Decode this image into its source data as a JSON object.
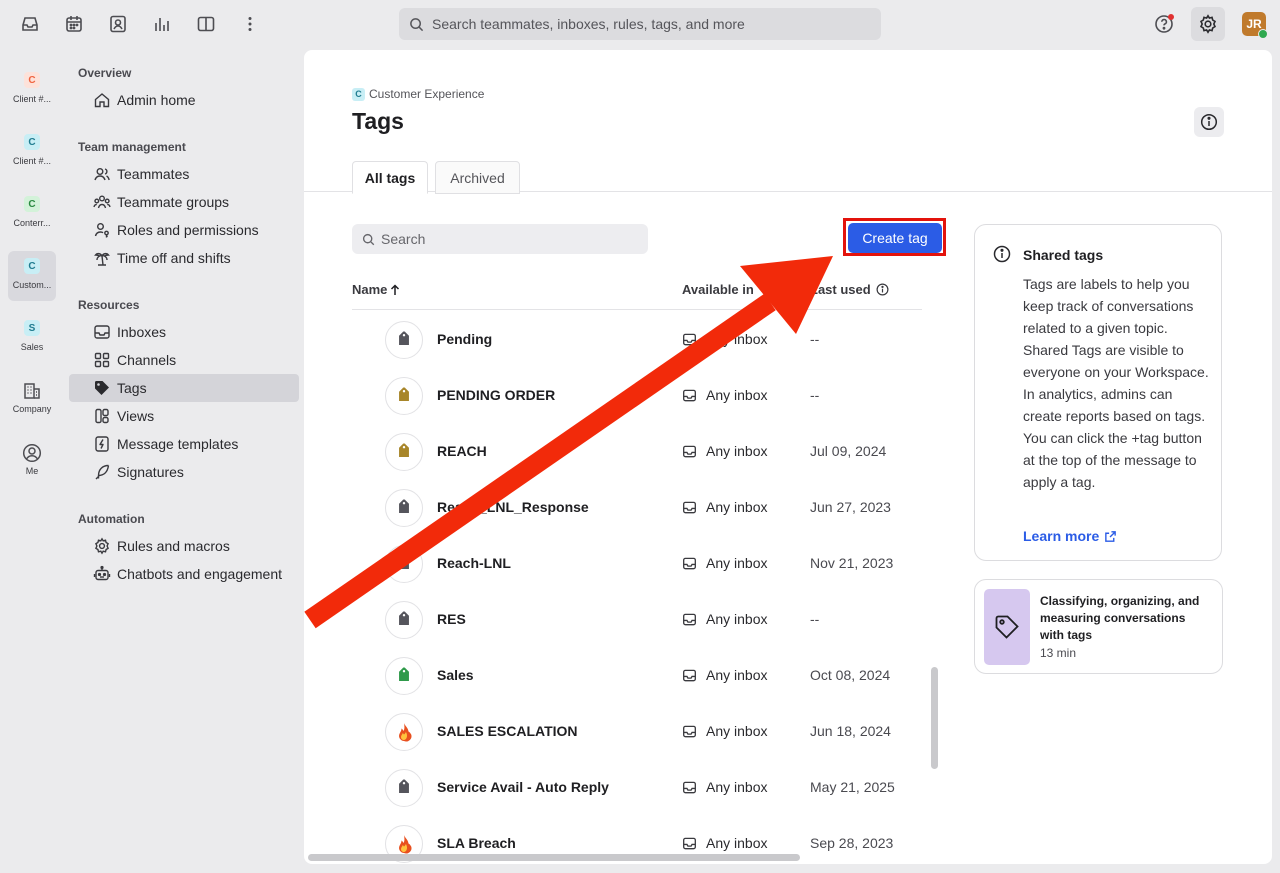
{
  "topbar": {
    "search_placeholder": "Search teammates, inboxes, rules, tags, and more",
    "avatar_initials": "JR"
  },
  "rail": {
    "workspaces": [
      {
        "letter": "C",
        "label": "Client #...",
        "color": "#f0633f",
        "bg": "#fde2da"
      },
      {
        "letter": "C",
        "label": "Client #...",
        "color": "#207c90",
        "bg": "#c8eef5"
      },
      {
        "letter": "C",
        "label": "Conterr...",
        "color": "#2a8a40",
        "bg": "#d3f2d9"
      },
      {
        "letter": "C",
        "label": "Custom...",
        "color": "#207c90",
        "bg": "#c8eef5"
      },
      {
        "letter": "S",
        "label": "Sales",
        "color": "#207c90",
        "bg": "#c8eef5"
      }
    ],
    "company_label": "Company",
    "me_label": "Me"
  },
  "sidebar": {
    "overview": {
      "heading": "Overview",
      "items": [
        "Admin home"
      ]
    },
    "team": {
      "heading": "Team management",
      "items": [
        "Teammates",
        "Teammate groups",
        "Roles and permissions",
        "Time off and shifts"
      ]
    },
    "resources": {
      "heading": "Resources",
      "items": [
        "Inboxes",
        "Channels",
        "Tags",
        "Views",
        "Message templates",
        "Signatures"
      ]
    },
    "automation": {
      "heading": "Automation",
      "items": [
        "Rules and macros",
        "Chatbots and engagement"
      ]
    }
  },
  "main": {
    "breadcrumb_badge": "C",
    "breadcrumb": "Customer Experience",
    "title": "Tags",
    "tabs": [
      "All tags",
      "Archived"
    ],
    "search_placeholder": "Search",
    "create_label": "Create tag",
    "columns": {
      "name": "Name",
      "available": "Available in",
      "last_used": "Last used"
    },
    "rows": [
      {
        "name": "Pending",
        "inbox": "Any inbox",
        "last": "--",
        "icon": "tag",
        "color": "#55555c"
      },
      {
        "name": "PENDING ORDER",
        "inbox": "Any inbox",
        "last": "--",
        "icon": "tag",
        "color": "#a8862a"
      },
      {
        "name": "REACH",
        "inbox": "Any inbox",
        "last": "Jul 09, 2024",
        "icon": "tag",
        "color": "#a8862a"
      },
      {
        "name": "Reach_LNL_Response",
        "inbox": "Any inbox",
        "last": "Jun 27, 2023",
        "icon": "tag",
        "color": "#55555c"
      },
      {
        "name": "Reach-LNL",
        "inbox": "Any inbox",
        "last": "Nov 21, 2023",
        "icon": "tag",
        "color": "#55555c"
      },
      {
        "name": "RES",
        "inbox": "Any inbox",
        "last": "--",
        "icon": "tag",
        "color": "#55555c"
      },
      {
        "name": "Sales",
        "inbox": "Any inbox",
        "last": "Oct 08, 2024",
        "icon": "tag",
        "color": "#2f9a4a"
      },
      {
        "name": "SALES ESCALATION",
        "inbox": "Any inbox",
        "last": "Jun 18, 2024",
        "icon": "fire",
        "color": "#e8501f"
      },
      {
        "name": "Service Avail - Auto Reply",
        "inbox": "Any inbox",
        "last": "May 21, 2025",
        "icon": "tag",
        "color": "#55555c"
      },
      {
        "name": "SLA Breach",
        "inbox": "Any inbox",
        "last": "Sep 28, 2023",
        "icon": "fire",
        "color": "#e8501f"
      }
    ]
  },
  "shared": {
    "title": "Shared tags",
    "body": "Tags are labels to help you keep track of conversations related to a given topic. Shared Tags are visible to everyone on your Workspace. In analytics, admins can create reports based on tags. You can click the +tag button at the top of the message to apply a tag.",
    "link": "Learn more"
  },
  "video": {
    "title": "Classifying, organizing, and measuring conversations with tags",
    "duration": "13 min"
  },
  "colors": {
    "accent": "#2b5ce6",
    "highlight": "#e3130c"
  }
}
